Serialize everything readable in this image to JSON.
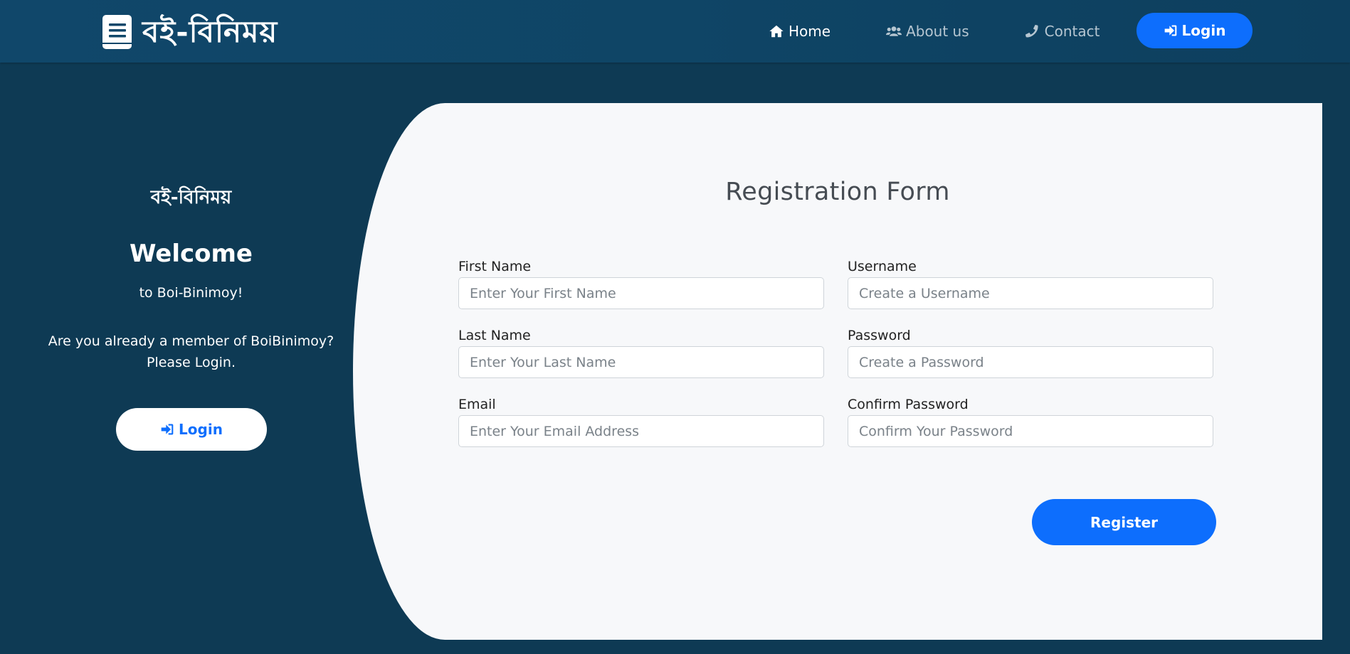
{
  "navbar": {
    "brand_text": "বই-বিনিময়",
    "links": [
      {
        "label": "Home",
        "icon": "home-icon"
      },
      {
        "label": "About us",
        "icon": "users-icon"
      },
      {
        "label": "Contact",
        "icon": "phone-icon"
      }
    ],
    "login_label": "Login",
    "login_icon": "sign-in-icon"
  },
  "left_panel": {
    "logo_text": "বই-বিনিময়",
    "welcome": "Welcome",
    "welcome_sub": "to Boi-Binimoy!",
    "member_line1": "Are you already a member of BoiBinimoy?",
    "member_line2": "Please Login.",
    "login_label": "Login"
  },
  "form": {
    "title": "Registration Form",
    "fields": {
      "first_name": {
        "label": "First Name",
        "placeholder": "Enter Your First Name"
      },
      "last_name": {
        "label": "Last Name",
        "placeholder": "Enter Your Last Name"
      },
      "email": {
        "label": "Email",
        "placeholder": "Enter Your Email Address"
      },
      "username": {
        "label": "Username",
        "placeholder": "Create a Username"
      },
      "password": {
        "label": "Password",
        "placeholder": "Create a Password"
      },
      "confirm_password": {
        "label": "Confirm Password",
        "placeholder": "Confirm Your Password"
      }
    },
    "register_label": "Register"
  },
  "colors": {
    "background": "#0e3a54",
    "navbar": "#10476a",
    "primary": "#0d6efd",
    "card": "#f7f8fa"
  }
}
